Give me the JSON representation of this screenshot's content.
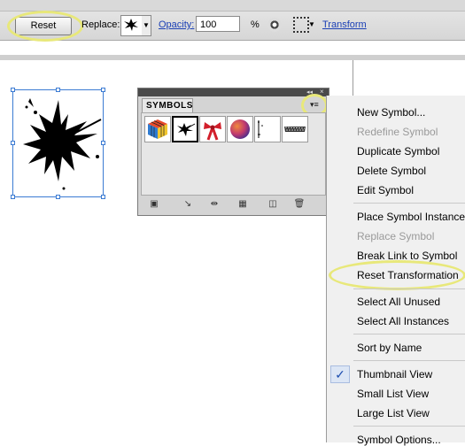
{
  "control_bar": {
    "reset_label": "Reset",
    "replace_label": "Replace:",
    "opacity_label": "Opacity:",
    "opacity_value": "100",
    "percent_label": "%",
    "transform_label": "Transform"
  },
  "symbols_panel": {
    "tab_label": "SYMBOLS",
    "symbols": [
      "cube-symbol",
      "ink-splat-symbol",
      "ribbon-bow-symbol",
      "gradient-sphere-symbol",
      "grunge-lines-symbol",
      "grunge-stripe-symbol"
    ],
    "selected_index": 1
  },
  "flyout_menu": {
    "items": [
      {
        "label": "New Symbol...",
        "enabled": true
      },
      {
        "label": "Redefine Symbol",
        "enabled": false
      },
      {
        "label": "Duplicate Symbol",
        "enabled": true
      },
      {
        "label": "Delete Symbol",
        "enabled": true
      },
      {
        "label": "Edit Symbol",
        "enabled": true
      },
      {
        "label": "Place Symbol Instance",
        "enabled": true
      },
      {
        "label": "Replace Symbol",
        "enabled": false
      },
      {
        "label": "Break Link to Symbol",
        "enabled": true
      },
      {
        "label": "Reset Transformation",
        "enabled": true
      },
      {
        "label": "Select All Unused",
        "enabled": true
      },
      {
        "label": "Select All Instances",
        "enabled": true
      },
      {
        "label": "Sort by Name",
        "enabled": true
      },
      {
        "label": "Thumbnail View",
        "enabled": true,
        "checked": true
      },
      {
        "label": "Small List View",
        "enabled": true
      },
      {
        "label": "Large List View",
        "enabled": true
      },
      {
        "label": "Symbol Options...",
        "enabled": true
      }
    ]
  },
  "colors": {
    "link_blue": "#1a3fb5",
    "selection_blue": "#3b7bd3",
    "highlight_yellow": "#e8e87a",
    "disabled_gray": "#9a9a9a"
  }
}
